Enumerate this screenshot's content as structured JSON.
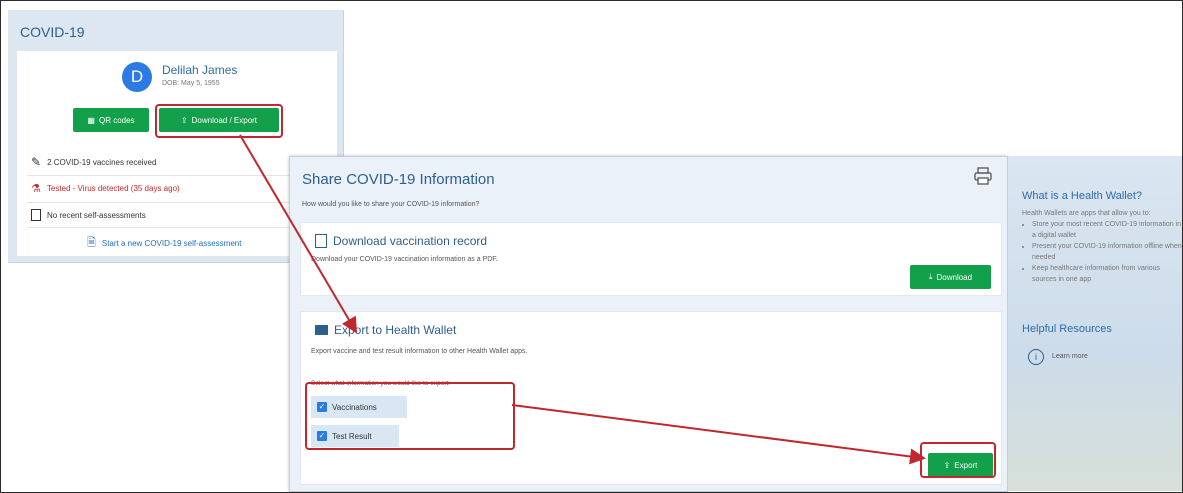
{
  "covid_panel": {
    "title": "COVID-19",
    "patient": {
      "initial": "D",
      "name": "Delilah James",
      "dob": "DOB: May 5, 1955"
    },
    "qr_button": "QR codes",
    "download_export_button": "Download / Export",
    "status_rows": [
      {
        "text": "2 COVID-19 vaccines received",
        "icon": "syringe-icon"
      },
      {
        "text": "Tested - Virus detected (35 days ago)",
        "icon": "test-tube-icon",
        "color": "#c62828"
      },
      {
        "text": "No recent self-assessments",
        "icon": "clipboard-icon"
      }
    ],
    "self_assessment_link": "Start a new COVID-19 self-assessment"
  },
  "dialog": {
    "title": "Share COVID-19 Information",
    "subtitle": "How would you like to share your COVID-19 information?",
    "download_section": {
      "title": "Download vaccination record",
      "description": "Download your COVID-19 vaccination information as a PDF.",
      "button": "Download"
    },
    "export_section": {
      "title": "Export to Health Wallet",
      "description": "Export vaccine and test result information to other Health Wallet apps.",
      "select_prompt": "Select what information you would like to export:",
      "options": [
        {
          "label": "Vaccinations",
          "checked": true
        },
        {
          "label": "Test Result",
          "checked": true
        }
      ],
      "button": "Export"
    }
  },
  "side_panel": {
    "title": "What is a Health Wallet?",
    "intro": "Health Wallets are apps that allow you to:",
    "bullets": [
      "Store your most recent COVID-19 information in a digital wallet",
      "Present your COVID-19 information offline when needed",
      "Keep healthcare information from various sources in one app"
    ],
    "resources_title": "Helpful Resources",
    "learn_more": "Learn more"
  },
  "colors": {
    "accent_green": "#13a04a",
    "accent_blue": "#2c7be5",
    "annotation_red": "#c0282d",
    "alert_red": "#c62828"
  }
}
